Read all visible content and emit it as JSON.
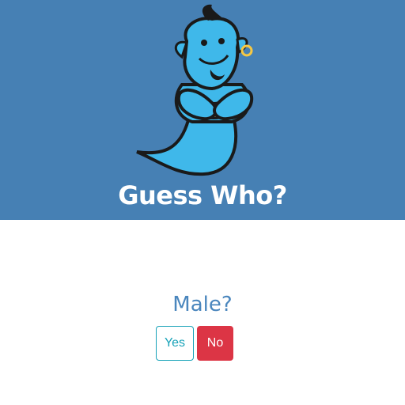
{
  "header": {
    "title": "Guess Who?",
    "background_color": "#4680b4",
    "logo_icon": "genie-icon"
  },
  "question": {
    "text": "Male?",
    "color": "#4a86bd"
  },
  "answers": {
    "yes_label": "Yes",
    "no_label": "No",
    "yes_color": "#17a2b8",
    "no_color": "#dc3545"
  }
}
